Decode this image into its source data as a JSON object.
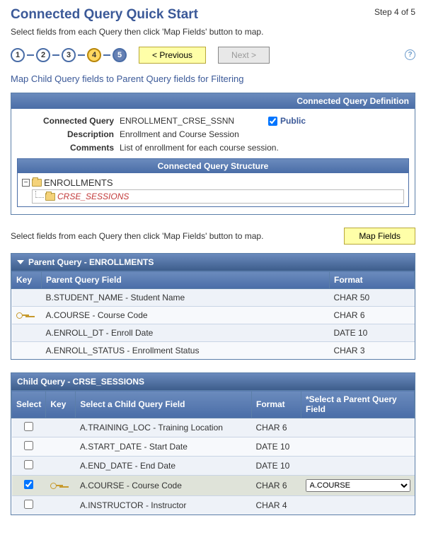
{
  "header": {
    "title": "Connected Query Quick Start",
    "step_text": "Step 4 of 5",
    "instruction": "Select fields from each Query then click 'Map Fields' button to map."
  },
  "steps": {
    "s1": "1",
    "s2": "2",
    "s3": "3",
    "s4": "4",
    "s5": "5",
    "prev_label": "< Previous",
    "next_label": "Next >",
    "help": "?"
  },
  "section_line": "Map Child Query fields to Parent Query fields for Filtering",
  "definition": {
    "header": "Connected Query Definition",
    "fields": {
      "connected_query_label": "Connected Query",
      "connected_query_value": "ENROLLMENT_CRSE_SSNN",
      "public_label": "Public",
      "description_label": "Description",
      "description_value": "Enrollment and Course Session",
      "comments_label": "Comments",
      "comments_value": "List of enrollment for each course session."
    },
    "structure": {
      "header": "Connected Query Structure",
      "root": "ENROLLMENTS",
      "child": "CRSE_SESSIONS"
    }
  },
  "map": {
    "instruction": "Select fields from each Query then click 'Map Fields' button to map.",
    "button": "Map Fields"
  },
  "parent": {
    "header": "Parent Query - ENROLLMENTS",
    "cols": {
      "key": "Key",
      "field": "Parent Query Field",
      "format": "Format"
    },
    "rows": [
      {
        "field": "B.STUDENT_NAME - Student Name",
        "format": "CHAR 50",
        "key": false
      },
      {
        "field": "A.COURSE - Course Code",
        "format": "CHAR 6",
        "key": true
      },
      {
        "field": "A.ENROLL_DT - Enroll Date",
        "format": "DATE 10",
        "key": false
      },
      {
        "field": "A.ENROLL_STATUS - Enrollment Status",
        "format": "CHAR 3",
        "key": false
      }
    ]
  },
  "child": {
    "header": "Child Query - CRSE_SESSIONS",
    "cols": {
      "select": "Select",
      "key": "Key",
      "field": "Select a Child Query Field",
      "format": "Format",
      "parent": "*Select a Parent Query Field"
    },
    "rows": [
      {
        "selected": false,
        "key": false,
        "field": "A.TRAINING_LOC - Training Location",
        "format": "CHAR 6",
        "parent": ""
      },
      {
        "selected": false,
        "key": false,
        "field": "A.START_DATE - Start Date",
        "format": "DATE 10",
        "parent": ""
      },
      {
        "selected": false,
        "key": false,
        "field": "A.END_DATE - End Date",
        "format": "DATE 10",
        "parent": ""
      },
      {
        "selected": true,
        "key": true,
        "field": "A.COURSE - Course Code",
        "format": "CHAR 6",
        "parent": "A.COURSE"
      },
      {
        "selected": false,
        "key": false,
        "field": "A.INSTRUCTOR - Instructor",
        "format": "CHAR 4",
        "parent": ""
      }
    ]
  }
}
